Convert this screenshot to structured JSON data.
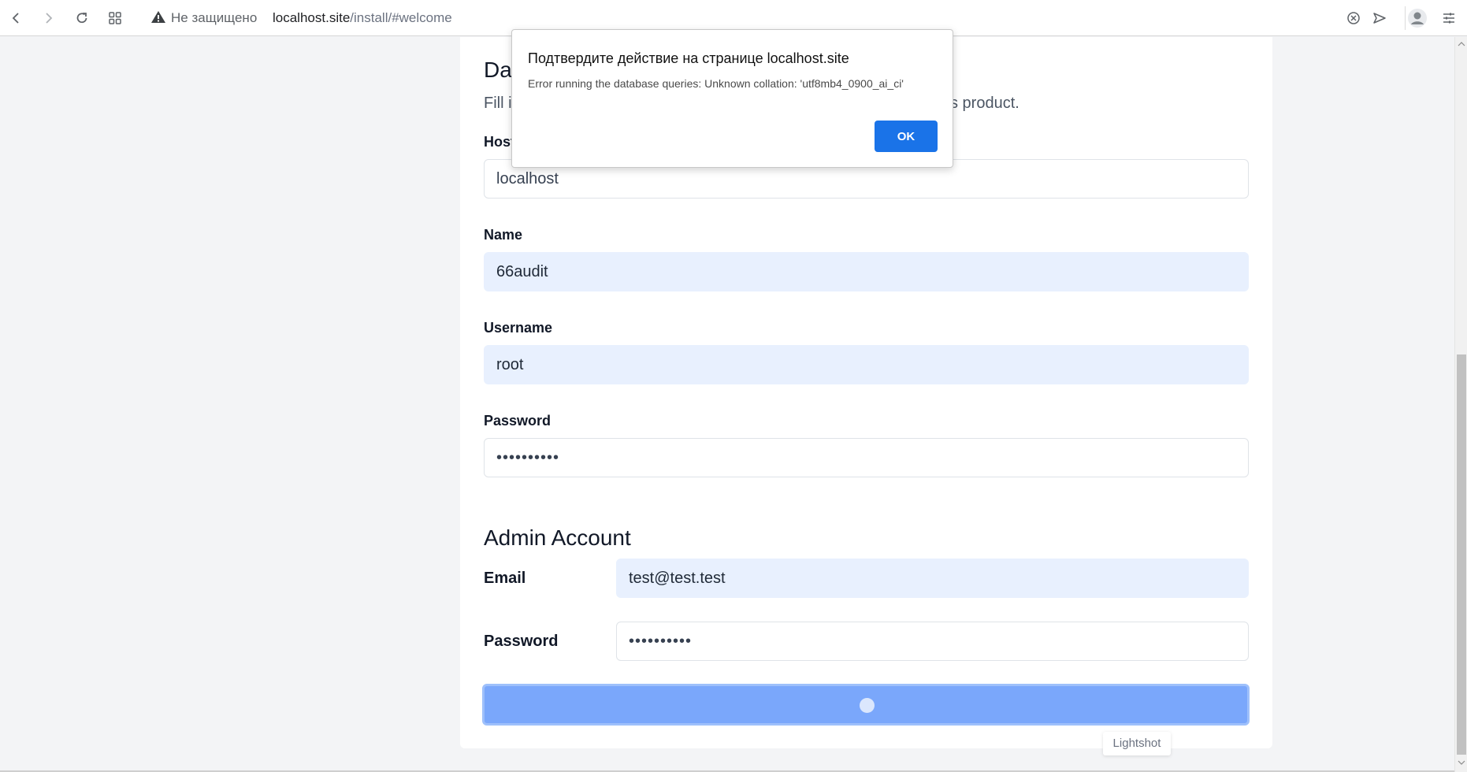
{
  "browser": {
    "security_label": "Не защищено",
    "url_host": "localhost.site",
    "url_path": "/install/#welcome"
  },
  "database": {
    "title_visible": "Dat",
    "desc_visible_start": "Fill i",
    "desc_visible_end": "s product.",
    "host_label": "Host",
    "host_value": "localhost",
    "name_label": "Name",
    "name_value": "66audit",
    "username_label": "Username",
    "username_value": "root",
    "password_label": "Password",
    "password_value": "••••••••••"
  },
  "admin": {
    "title": "Admin Account",
    "email_label": "Email",
    "email_value": "test@test.test",
    "password_label": "Password",
    "password_value": "••••••••••"
  },
  "tooltip": "Lightshot",
  "dialog": {
    "title": "Подтвердите действие на странице localhost.site",
    "message": "Error running the database queries: Unknown collation: 'utf8mb4_0900_ai_ci'",
    "ok_label": "OK"
  },
  "colors": {
    "accent": "#1a73e8",
    "submit_bg": "#7aa7fb",
    "autofill_bg": "#e8f0fe"
  }
}
